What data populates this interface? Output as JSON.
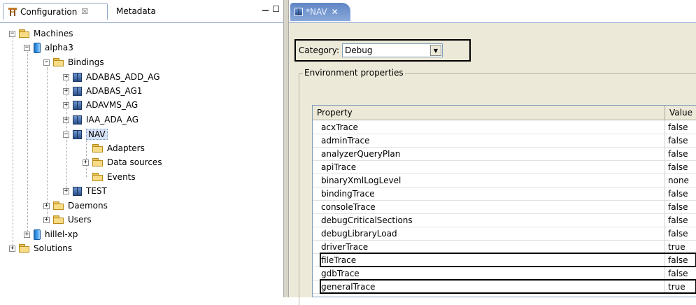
{
  "left_panel": {
    "tabs": [
      {
        "label": "Configuration",
        "close": "☒"
      },
      {
        "label": "Metadata"
      }
    ]
  },
  "tree": [
    {
      "label": "Machines",
      "depth": 0,
      "kind": "folder",
      "expander": "−"
    },
    {
      "label": "alpha3",
      "depth": 1,
      "kind": "machine",
      "expander": "−"
    },
    {
      "label": "Bindings",
      "depth": 2,
      "kind": "folder",
      "expander": "−"
    },
    {
      "label": "ADABAS_ADD_AG",
      "depth": 3,
      "kind": "binding",
      "expander": "+"
    },
    {
      "label": "ADABAS_AG1",
      "depth": 3,
      "kind": "binding",
      "expander": "+"
    },
    {
      "label": "ADAVMS_AG",
      "depth": 3,
      "kind": "binding",
      "expander": "+"
    },
    {
      "label": "IAA_ADA_AG",
      "depth": 3,
      "kind": "binding",
      "expander": "+"
    },
    {
      "label": "NAV",
      "depth": 3,
      "kind": "binding",
      "expander": "−",
      "selected": true
    },
    {
      "label": "Adapters",
      "depth": 4,
      "kind": "folder",
      "expander": ""
    },
    {
      "label": "Data sources",
      "depth": 4,
      "kind": "folder",
      "expander": "+"
    },
    {
      "label": "Events",
      "depth": 4,
      "kind": "folder",
      "expander": ""
    },
    {
      "label": "TEST",
      "depth": 3,
      "kind": "binding",
      "expander": "+"
    },
    {
      "label": "Daemons",
      "depth": 2,
      "kind": "folder",
      "expander": "+"
    },
    {
      "label": "Users",
      "depth": 2,
      "kind": "folder",
      "expander": "+"
    },
    {
      "label": "hillel-xp",
      "depth": 1,
      "kind": "machine",
      "expander": "+"
    },
    {
      "label": "Solutions",
      "depth": 0,
      "kind": "folder",
      "expander": "+"
    }
  ],
  "editor": {
    "tab_label": "*NAV",
    "tab_close": "✕",
    "category_label": "Category:",
    "category_value": "Debug",
    "group_title": "Environment properties",
    "columns": [
      "Property",
      "Value"
    ],
    "rows": [
      {
        "property": "acxTrace",
        "value": "false"
      },
      {
        "property": "adminTrace",
        "value": "false"
      },
      {
        "property": "analyzerQueryPlan",
        "value": "false"
      },
      {
        "property": "apiTrace",
        "value": "false"
      },
      {
        "property": "binaryXmlLogLevel",
        "value": "none"
      },
      {
        "property": "bindingTrace",
        "value": "false"
      },
      {
        "property": "consoleTrace",
        "value": "false"
      },
      {
        "property": "debugCriticalSections",
        "value": "false"
      },
      {
        "property": "debugLibraryLoad",
        "value": "false"
      },
      {
        "property": "driverTrace",
        "value": "true"
      },
      {
        "property": "fileTrace",
        "value": "false",
        "highlighted": true
      },
      {
        "property": "gdbTrace",
        "value": "false"
      },
      {
        "property": "generalTrace",
        "value": "true",
        "highlighted": true
      }
    ]
  }
}
